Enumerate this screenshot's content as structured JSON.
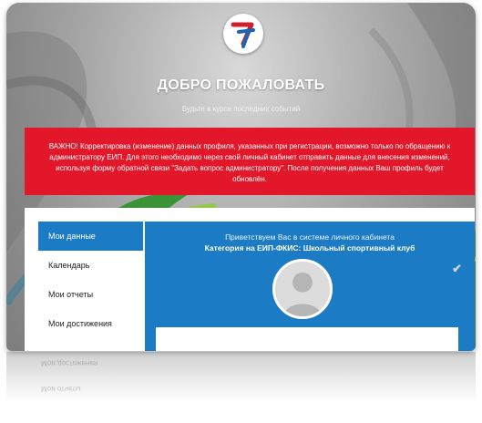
{
  "header": {
    "title": "ДОБРО ПОЖАЛОВАТЬ",
    "subtitle": "Будьте в курсе последних событий",
    "logo_icon": "eip-logo-icon"
  },
  "alert": {
    "text": "ВАЖНО! Корректировка (изменение) данных профиля, указанных при регистрации, возможно только по обращению к администратору ЕИП. Для этого необходимо через свой личный кабинет отправить данные для внесения изменений, используя форму обратной связи \"Задать вопрос администратору\". После получения данных Ваш профиль будет обновлён.",
    "color": "#e3172a"
  },
  "sidebar": {
    "items": [
      {
        "label": "Мои данные",
        "active": true
      },
      {
        "label": "Календарь",
        "active": false
      },
      {
        "label": "Мои отчеты",
        "active": false
      },
      {
        "label": "Мои достижения",
        "active": false
      }
    ],
    "reflection_items": [
      "Мои достижения",
      "Мои отчеты"
    ]
  },
  "profile": {
    "greeting": "Приветствуем Вас в системе личного кабинета",
    "category": "Категория на ЕИП-ФКИС: Школьный спортивный клуб",
    "status_icon": "check-icon",
    "accent": "#1b7bc4"
  }
}
